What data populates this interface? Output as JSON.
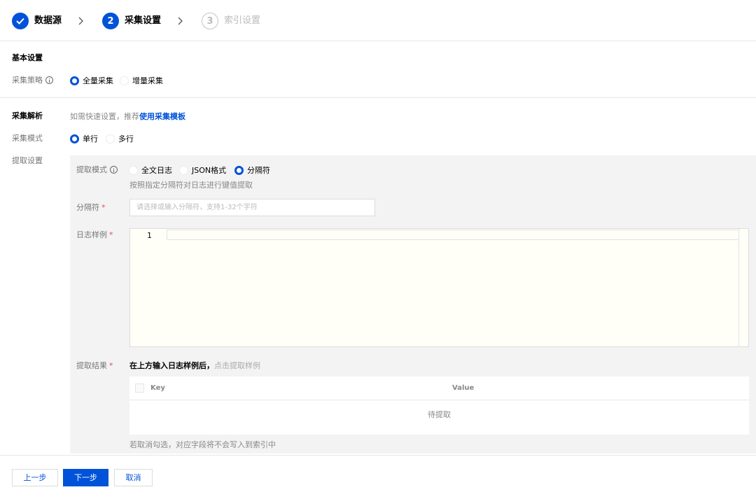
{
  "steps": [
    {
      "label": "数据源",
      "state": "done"
    },
    {
      "number": "2",
      "label": "采集设置",
      "state": "active"
    },
    {
      "number": "3",
      "label": "索引设置",
      "state": "todo"
    }
  ],
  "basic": {
    "title": "基本设置",
    "strategy_label": "采集策略",
    "strategy_options": [
      "全量采集",
      "增量采集"
    ],
    "strategy_selected": "全量采集"
  },
  "parse": {
    "title": "采集解析",
    "tip_prefix": "如需快速设置，推荐",
    "tip_link": "使用采集模板",
    "mode_label": "采集模式",
    "mode_options": [
      "单行",
      "多行"
    ],
    "mode_selected": "单行",
    "extract_label": "提取设置"
  },
  "extract": {
    "mode_label": "提取模式",
    "mode_options": [
      "全文日志",
      "JSON格式",
      "分隔符"
    ],
    "mode_selected": "分隔符",
    "mode_hint": "按照指定分隔符对日志进行键值提取",
    "delimiter_label": "分隔符",
    "delimiter_placeholder": "请选择或输入分隔符，支持1-32个字符",
    "sample_label": "日志样例",
    "sample_line_number": "1",
    "result_label": "提取结果",
    "result_tip_prefix": "在上方输入日志样例后，",
    "result_tip_action": "点击提取样例",
    "table_headers": [
      "Key",
      "Value"
    ],
    "table_empty": "待提取",
    "uncheck_hint": "若取消勾选，对应字段将不会写入到索引中"
  },
  "required_mark": "*",
  "footer": {
    "prev": "上一步",
    "next": "下一步",
    "cancel": "取消"
  },
  "colors": {
    "primary": "#0052d9",
    "required": "#e34d59"
  }
}
